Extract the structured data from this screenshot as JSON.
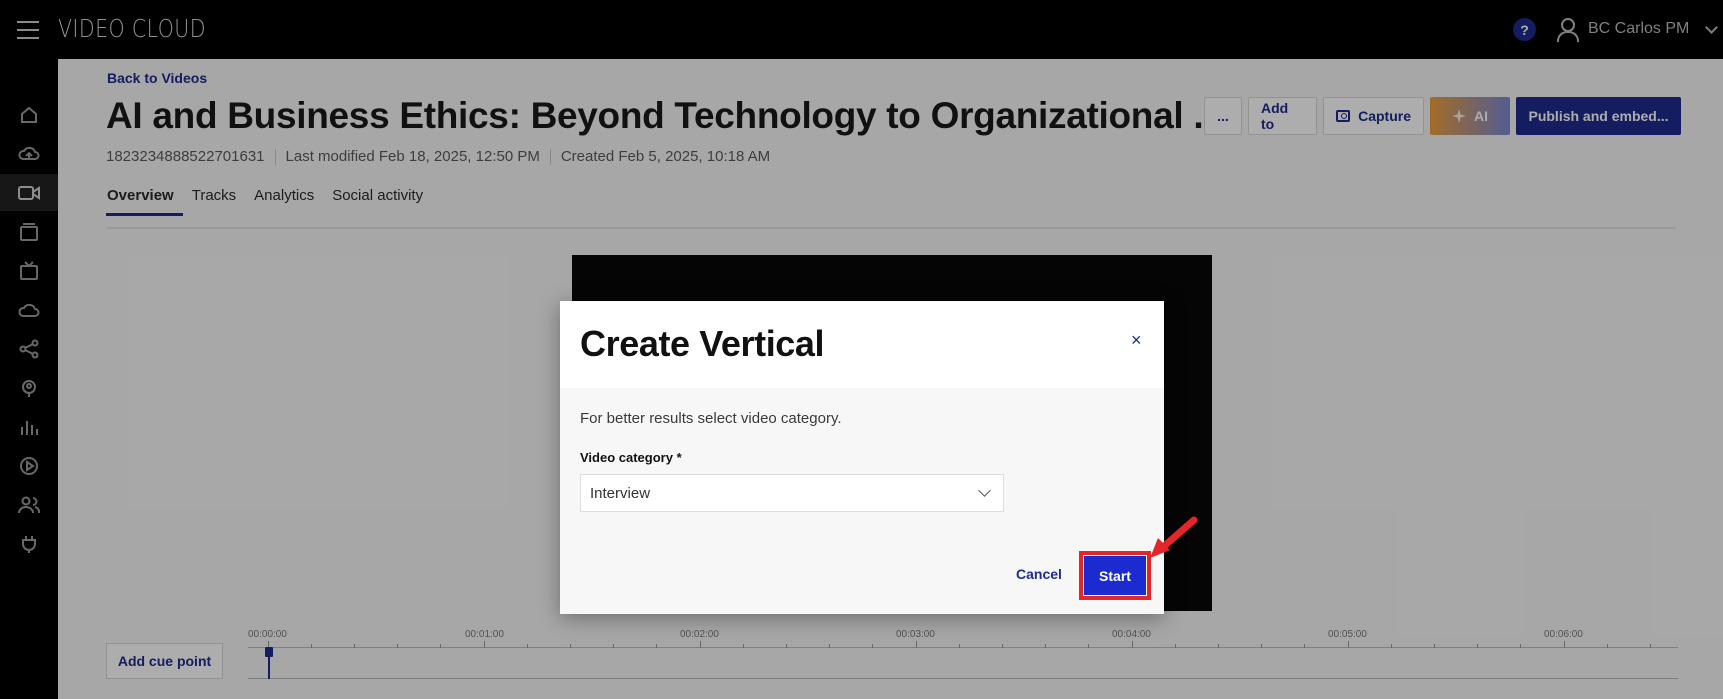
{
  "topbar": {
    "brand": "VIDEO CLOUD",
    "help_label": "?",
    "user_name": "BC Carlos PM"
  },
  "sidebar": {
    "items": [
      {
        "icon": "home-icon"
      },
      {
        "icon": "upload-icon"
      },
      {
        "icon": "video-icon",
        "active": true
      },
      {
        "icon": "media-library-icon"
      },
      {
        "icon": "live-tv-icon"
      },
      {
        "icon": "cloud-icon"
      },
      {
        "icon": "share-icon"
      },
      {
        "icon": "audience-icon"
      },
      {
        "icon": "analytics-icon"
      },
      {
        "icon": "players-icon"
      },
      {
        "icon": "users-icon"
      },
      {
        "icon": "plugins-icon"
      }
    ]
  },
  "page": {
    "back_link": "Back to Videos",
    "title": "AI and Business Ethics: Beyond Technology to Organizational ...",
    "meta": {
      "id": "1823234888522701631",
      "last_modified": "Last modified Feb 18, 2025, 12:50 PM",
      "created": "Created Feb 5, 2025, 10:18 AM"
    },
    "actions": {
      "more": "...",
      "add_to": "Add to",
      "capture": "Capture",
      "ai": "AI",
      "publish": "Publish and embed..."
    },
    "tabs": [
      "Overview",
      "Tracks",
      "Analytics",
      "Social activity"
    ],
    "active_tab": "Overview",
    "timeline": {
      "labels": [
        "00:00:00",
        "00:01:00",
        "00:02:00",
        "00:03:00",
        "00:04:00",
        "00:05:00",
        "00:06:00"
      ]
    },
    "add_cue_point": "Add cue point"
  },
  "modal": {
    "title": "Create Vertical",
    "close": "×",
    "description": "For better results select video category.",
    "field_label": "Video category *",
    "selected_category": "Interview",
    "cancel": "Cancel",
    "start": "Start"
  },
  "colors": {
    "brand_blue": "#1e2b8c",
    "start_blue": "#1b2bd0",
    "highlight_red": "#e4262b"
  }
}
